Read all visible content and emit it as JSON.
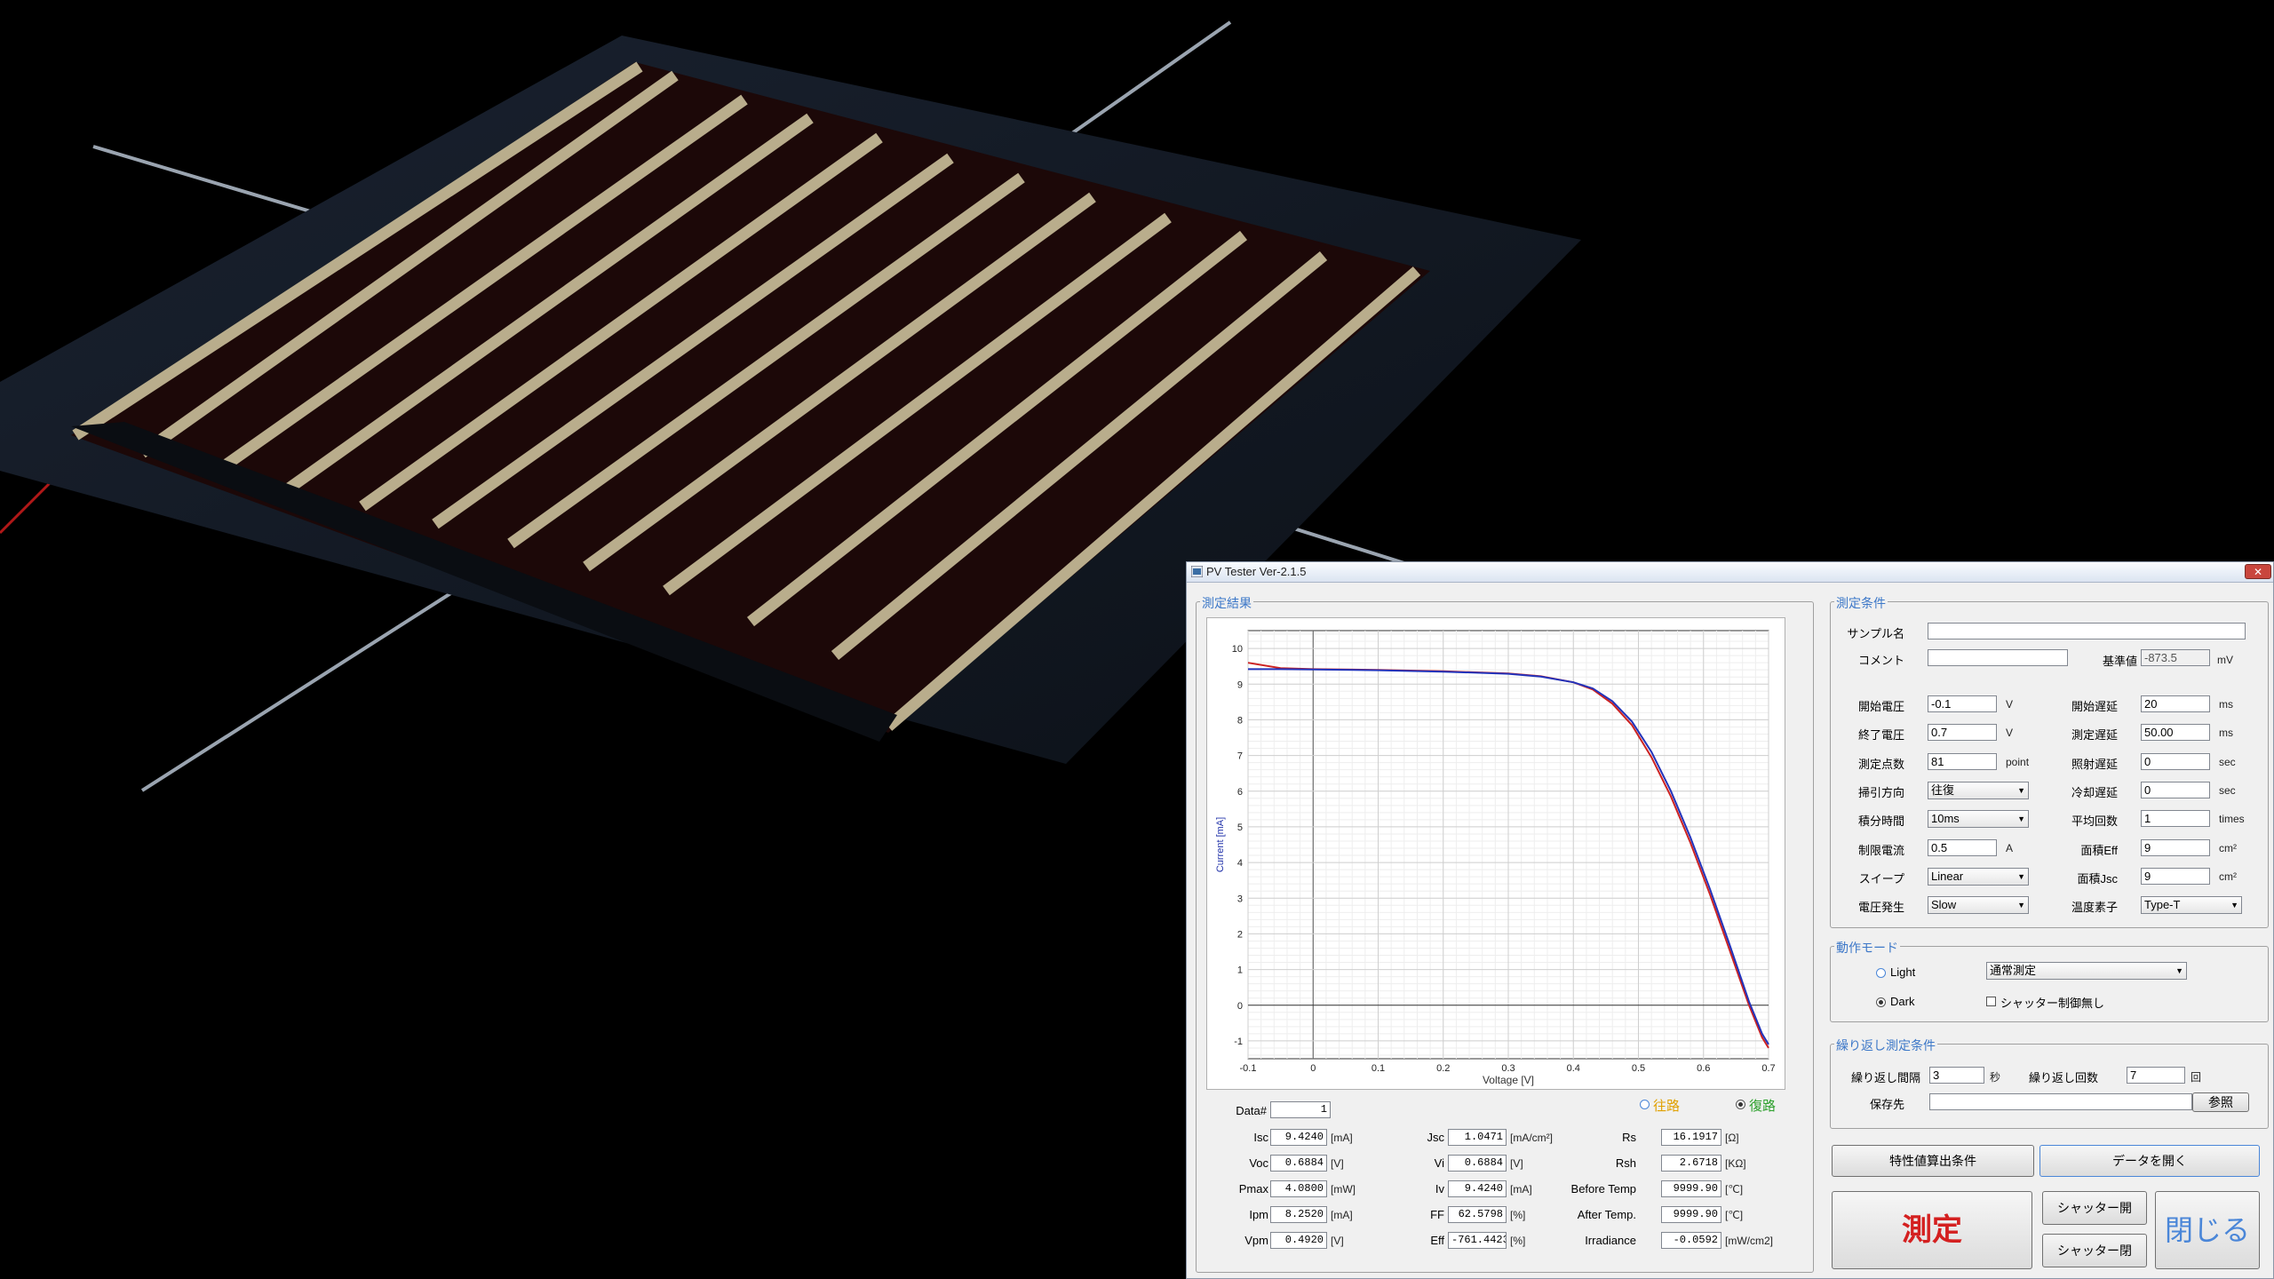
{
  "window": {
    "title": "PV Tester Ver-2.1.5",
    "close": "✕"
  },
  "results_panel": {
    "title": "測定結果",
    "direction_forward": "往路",
    "direction_reverse": "復路",
    "data_no_label": "Data#",
    "data_no": "1",
    "fields": [
      {
        "label": "Isc",
        "value": "9.4240",
        "unit": "[mA]"
      },
      {
        "label": "Voc",
        "value": "0.6884",
        "unit": "[V]"
      },
      {
        "label": "Pmax",
        "value": "4.0800",
        "unit": "[mW]"
      },
      {
        "label": "Ipm",
        "value": "8.2520",
        "unit": "[mA]"
      },
      {
        "label": "Vpm",
        "value": "0.4920",
        "unit": "[V]"
      },
      {
        "label": "Jsc",
        "value": "1.0471",
        "unit": "[mA/cm²]"
      },
      {
        "label": "Vi",
        "value": "0.6884",
        "unit": "[V]"
      },
      {
        "label": "Iv",
        "value": "9.4240",
        "unit": "[mA]"
      },
      {
        "label": "FF",
        "value": "62.5798",
        "unit": "[%]"
      },
      {
        "label": "Eff",
        "value": "-761.4423",
        "unit": "[%]"
      },
      {
        "label": "Rs",
        "value": "16.1917",
        "unit": "[Ω]"
      },
      {
        "label": "Rsh",
        "value": "2.6718",
        "unit": "[KΩ]"
      },
      {
        "label": "Before Temp",
        "value": "9999.90",
        "unit": "[℃]"
      },
      {
        "label": "After Temp.",
        "value": "9999.90",
        "unit": "[℃]"
      },
      {
        "label": "Irradiance",
        "value": "-0.0592",
        "unit": "[mW/cm2]"
      }
    ]
  },
  "chart_data": {
    "type": "line",
    "xlabel": "Voltage [V]",
    "ylabel": "Current [mA]",
    "xlim": [
      -0.1,
      0.7
    ],
    "ylim": [
      -1.5,
      10.5
    ],
    "x_ticks": [
      "-0.1",
      "0",
      "0.1",
      "0.2",
      "0.3",
      "0.4",
      "0.5",
      "0.6",
      "0.7"
    ],
    "x_tick_values": [
      -0.1,
      0,
      0.1,
      0.2,
      0.3,
      0.4,
      0.5,
      0.6,
      0.7
    ],
    "y_ticks": [
      -1,
      0,
      1,
      2,
      3,
      4,
      5,
      6,
      7,
      8,
      9,
      10
    ],
    "grid": true,
    "series": [
      {
        "color": "#cc2222",
        "x": [
          -0.1,
          -0.05,
          0,
          0.1,
          0.2,
          0.3,
          0.35,
          0.4,
          0.43,
          0.46,
          0.49,
          0.52,
          0.55,
          0.58,
          0.61,
          0.64,
          0.67,
          0.69,
          0.7
        ],
        "y": [
          9.6,
          9.45,
          9.42,
          9.4,
          9.36,
          9.3,
          9.22,
          9.05,
          8.85,
          8.45,
          7.85,
          6.95,
          5.85,
          4.55,
          3.1,
          1.55,
          0.0,
          -0.9,
          -1.2
        ]
      },
      {
        "color": "#2233bb",
        "x": [
          -0.1,
          -0.05,
          0,
          0.1,
          0.2,
          0.3,
          0.35,
          0.4,
          0.43,
          0.46,
          0.49,
          0.52,
          0.55,
          0.58,
          0.61,
          0.64,
          0.67,
          0.69,
          0.7
        ],
        "y": [
          9.42,
          9.42,
          9.41,
          9.39,
          9.35,
          9.29,
          9.21,
          9.05,
          8.88,
          8.52,
          7.95,
          7.1,
          6.0,
          4.7,
          3.25,
          1.7,
          0.1,
          -0.8,
          -1.1
        ]
      }
    ]
  },
  "conditions": {
    "title": "測定条件",
    "sample_label": "サンプル名",
    "sample_value": "",
    "comment_label": "コメント",
    "comment_value": "",
    "ref_label": "基準値",
    "ref_value": "-873.5",
    "ref_unit": "mV",
    "start_v_label": "開始電圧",
    "start_v": "-0.1",
    "start_v_unit": "V",
    "end_v_label": "終了電圧",
    "end_v": "0.7",
    "end_v_unit": "V",
    "points_label": "測定点数",
    "points": "81",
    "points_unit": "point",
    "sweep_dir_label": "掃引方向",
    "sweep_dir": "往復",
    "integ_label": "積分時間",
    "integ": "10ms",
    "limit_label": "制限電流",
    "limit": "0.5",
    "limit_unit": "A",
    "sweep_label": "スイープ",
    "sweep": "Linear",
    "vgen_label": "電圧発生",
    "vgen": "Slow",
    "start_delay_label": "開始遅延",
    "start_delay": "20",
    "start_delay_unit": "ms",
    "meas_delay_label": "測定遅延",
    "meas_delay": "50.00",
    "meas_delay_unit": "ms",
    "irr_delay_label": "照射遅延",
    "irr_delay": "0",
    "irr_delay_unit": "sec",
    "cool_delay_label": "冷却遅延",
    "cool_delay": "0",
    "cool_delay_unit": "sec",
    "avg_label": "平均回数",
    "avg": "1",
    "avg_unit": "times",
    "area_eff_label": "面積Eff",
    "area_eff": "9",
    "area_eff_unit": "cm²",
    "area_jsc_label": "面積Jsc",
    "area_jsc": "9",
    "area_jsc_unit": "cm²",
    "temp_label": "温度素子",
    "temp": "Type-T"
  },
  "mode": {
    "title": "動作モード",
    "light": "Light",
    "dark": "Dark",
    "mode_value": "通常測定",
    "shutter_check": "シャッター制御無し"
  },
  "repeat": {
    "title": "繰り返し測定条件",
    "interval_label": "繰り返し間隔",
    "interval": "3",
    "interval_unit": "秒",
    "count_label": "繰り返し回数",
    "count": "7",
    "count_unit": "回",
    "save_label": "保存先",
    "save_value": "",
    "browse": "参照"
  },
  "buttons": {
    "calc_conditions": "特性値算出条件",
    "open_data": "データを開く",
    "measure": "測定",
    "shutter_open": "シャッター開",
    "shutter_close": "シャッター閉",
    "close": "閉じる"
  },
  "colors": {
    "accent": "#3d78c8",
    "measure": "#d42020",
    "close_text": "#4a86d8",
    "forward": "#e0a000",
    "reverse": "#2ca02c"
  }
}
